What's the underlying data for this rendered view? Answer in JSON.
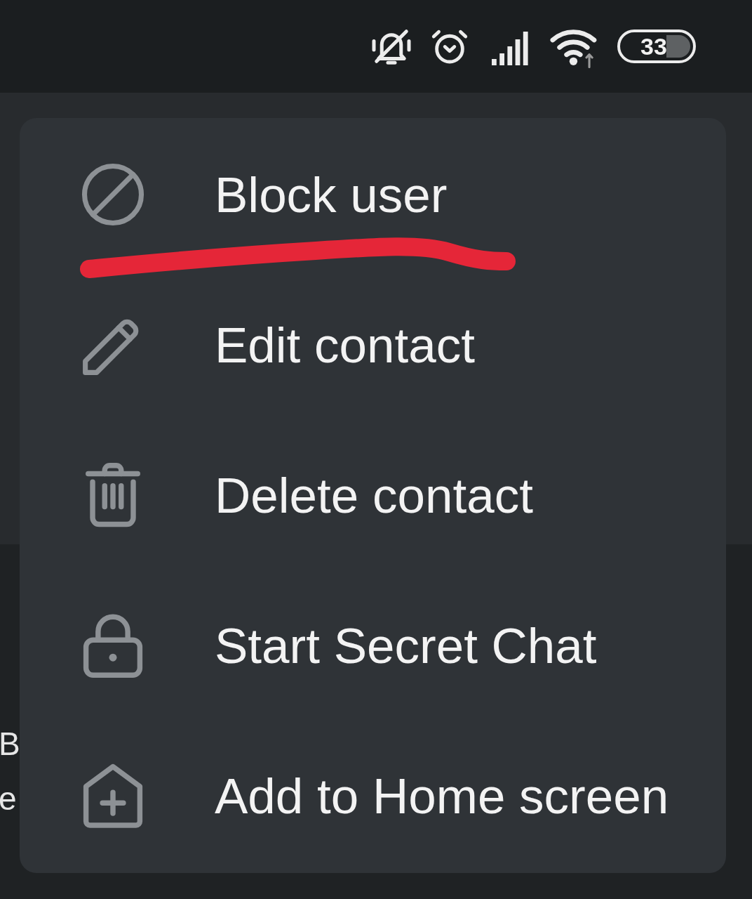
{
  "status_bar": {
    "battery_percent": "33"
  },
  "background": {
    "obscured_texts": [
      {
        "text": "B"
      },
      {
        "text": "e"
      }
    ]
  },
  "menu": {
    "items": [
      {
        "kind": "block",
        "label": "Block user",
        "underlined": true
      },
      {
        "kind": "edit",
        "label": "Edit contact",
        "underlined": false
      },
      {
        "kind": "delete",
        "label": "Delete contact",
        "underlined": false
      },
      {
        "kind": "secret",
        "label": "Start Secret Chat",
        "underlined": false
      },
      {
        "kind": "home",
        "label": "Add to Home screen",
        "underlined": false
      }
    ]
  }
}
